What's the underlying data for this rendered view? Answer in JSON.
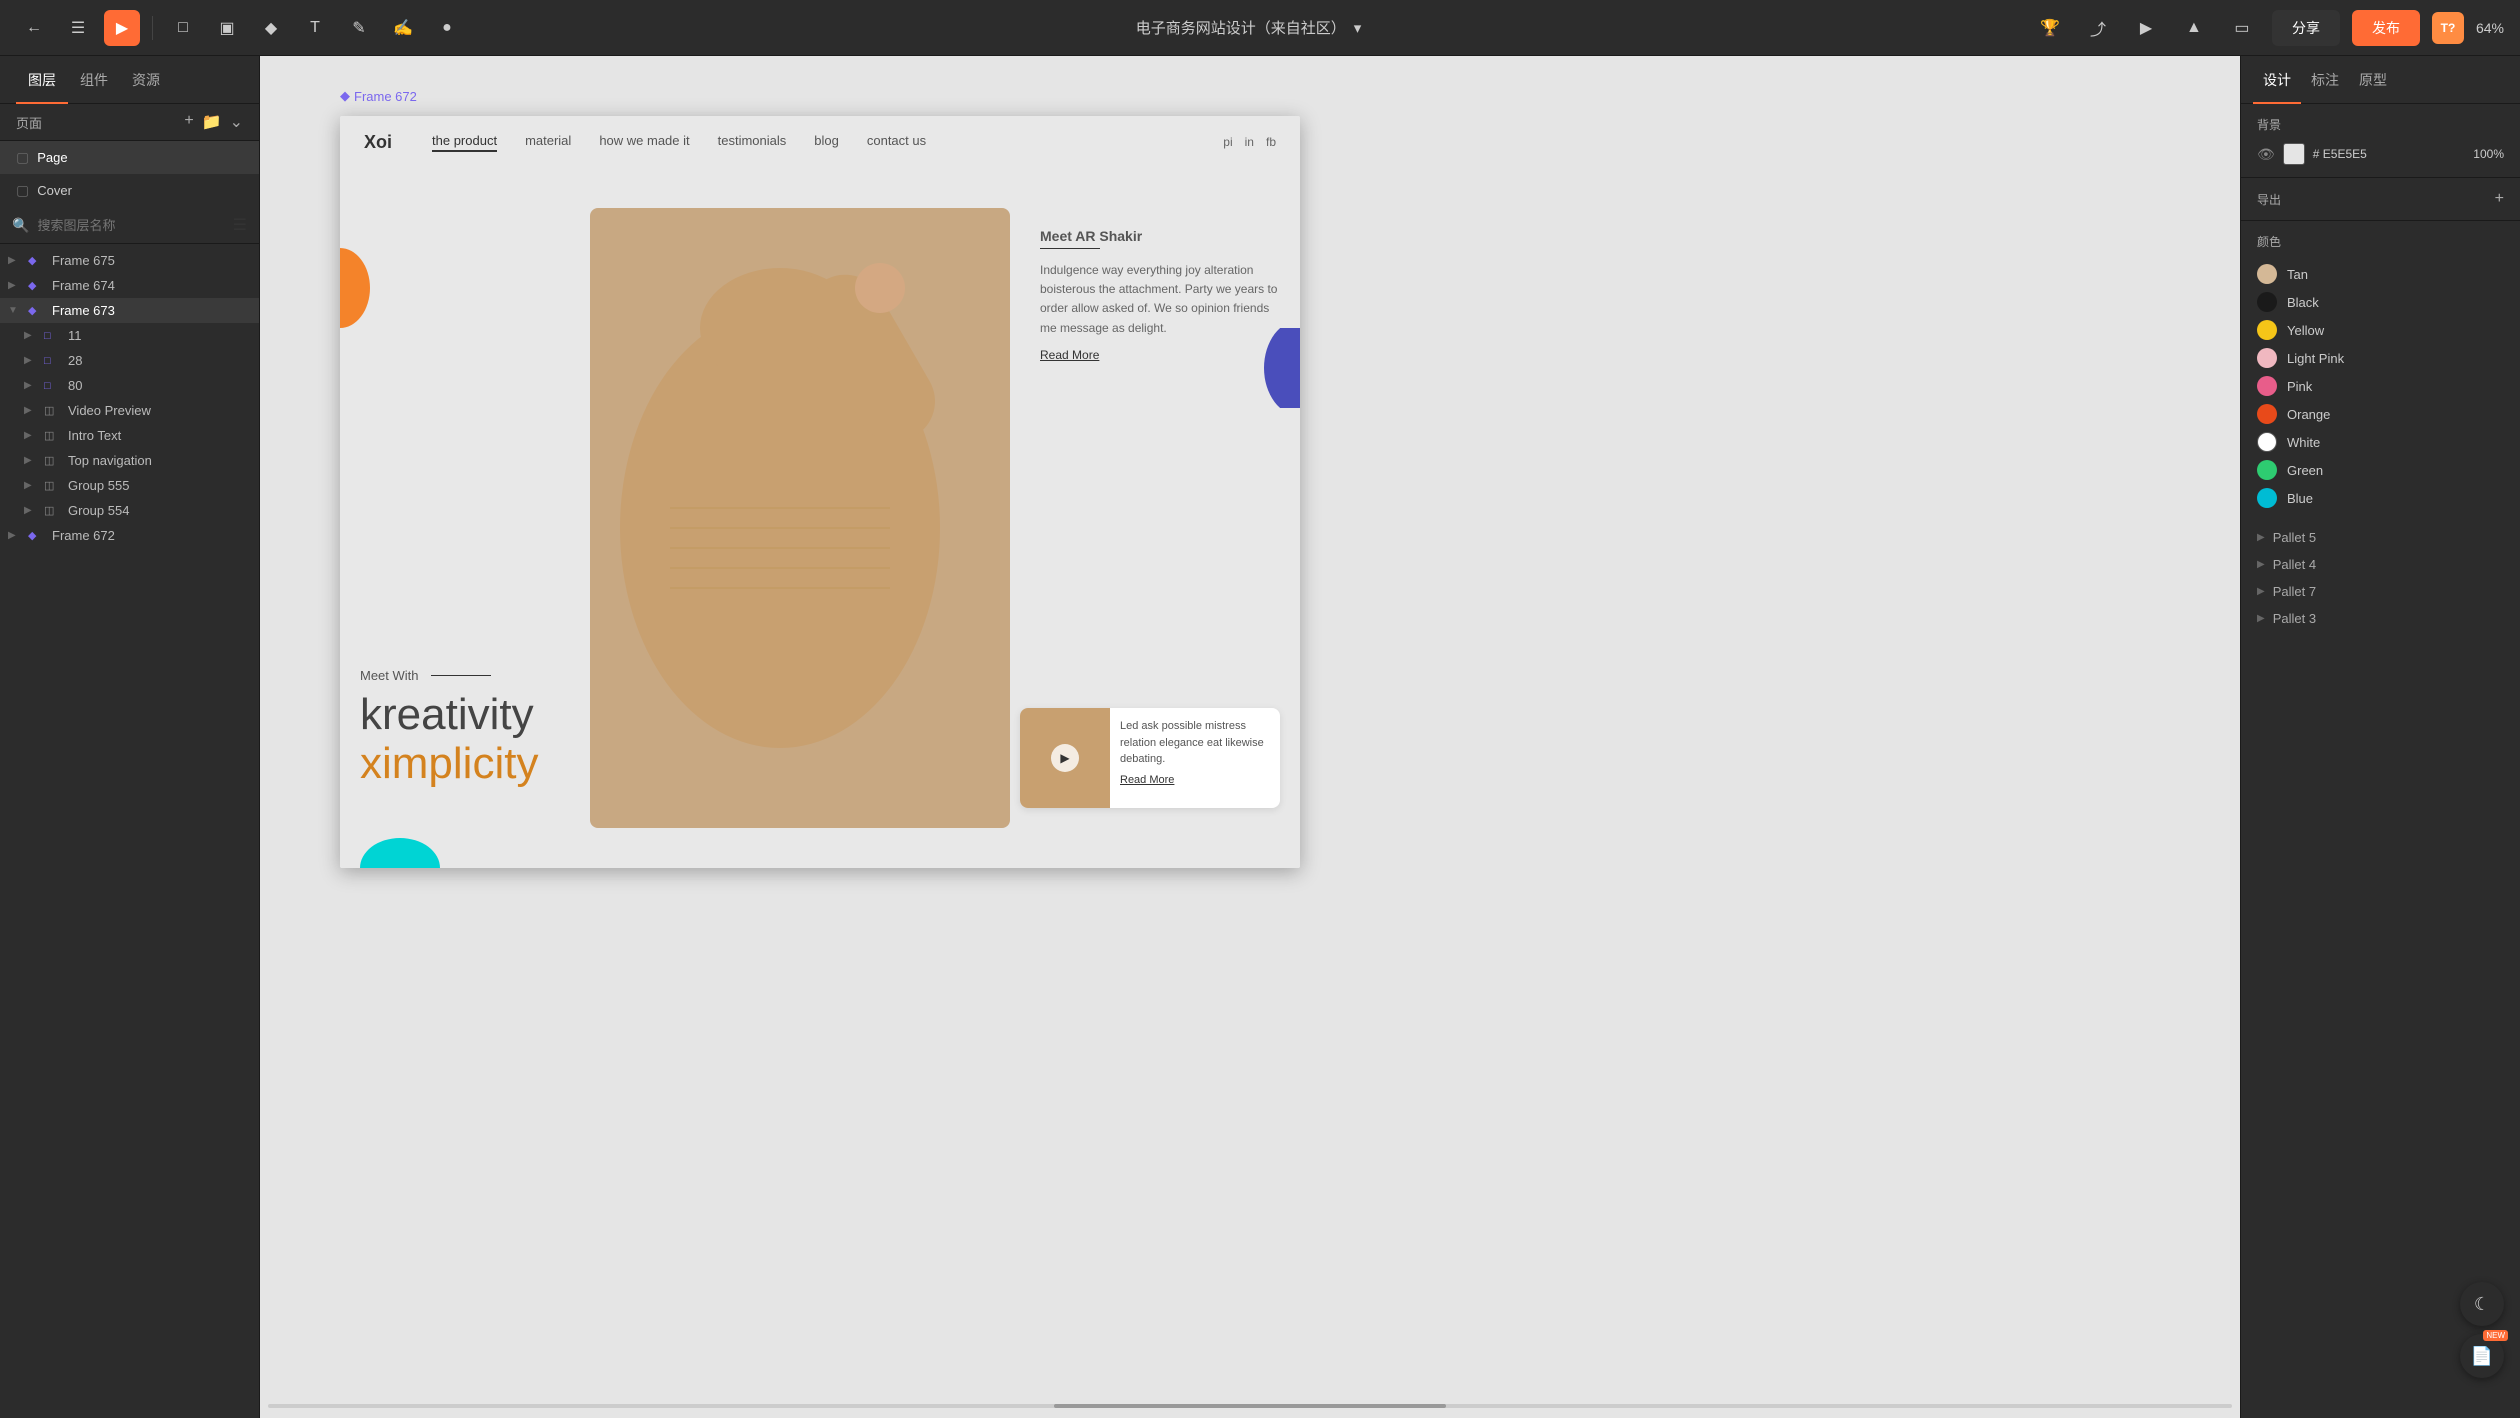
{
  "toolbar": {
    "title": "电子商务网站设计（来自社区）",
    "title_arrow": "▾",
    "share_label": "分享",
    "publish_label": "发布",
    "zoom": "64%",
    "avatar_text": "T?"
  },
  "left_panel": {
    "tabs": [
      "图层",
      "组件",
      "资源"
    ],
    "pages_label": "页面",
    "pages": [
      {
        "name": "Page",
        "active": true
      },
      {
        "name": "Cover",
        "active": false
      }
    ],
    "search_placeholder": "搜索图层名称",
    "layers": [
      {
        "id": "frame675",
        "name": "Frame 675",
        "indent": 0,
        "type": "diamond",
        "expanded": false
      },
      {
        "id": "frame674",
        "name": "Frame 674",
        "indent": 0,
        "type": "diamond",
        "expanded": false
      },
      {
        "id": "frame673",
        "name": "Frame 673",
        "indent": 0,
        "type": "diamond",
        "expanded": true,
        "active": true
      },
      {
        "id": "l11",
        "name": "11",
        "indent": 1,
        "type": "frame"
      },
      {
        "id": "l28",
        "name": "28",
        "indent": 1,
        "type": "frame"
      },
      {
        "id": "l80",
        "name": "80",
        "indent": 1,
        "type": "frame"
      },
      {
        "id": "video_preview",
        "name": "Video Preview",
        "indent": 1,
        "type": "group"
      },
      {
        "id": "intro_text",
        "name": "Intro Text",
        "indent": 1,
        "type": "group"
      },
      {
        "id": "top_navigation",
        "name": "Top navigation",
        "indent": 1,
        "type": "group"
      },
      {
        "id": "group555",
        "name": "Group 555",
        "indent": 1,
        "type": "group"
      },
      {
        "id": "group554",
        "name": "Group 554",
        "indent": 1,
        "type": "group"
      },
      {
        "id": "frame672",
        "name": "Frame 672",
        "indent": 0,
        "type": "diamond"
      }
    ]
  },
  "canvas": {
    "frame_label": "Frame 672",
    "mockup": {
      "nav": {
        "logo": "Xoi",
        "links": [
          "the product",
          "material",
          "how we made it",
          "testimonials",
          "blog",
          "contact us"
        ],
        "active_link": "the product",
        "social": [
          "pi",
          "in",
          "fb"
        ]
      },
      "hero": {
        "meet_ar_title": "Meet AR Shakir",
        "meet_desc": "Indulgence way everything joy alteration boisterous the attachment. Party we years to order allow asked of. We so opinion friends me message as delight.",
        "read_more": "Read More",
        "meet_with": "Meet With",
        "headline1": "kreativity",
        "headline2": "ximplicity",
        "video_text": "Led ask possible mistress relation elegance eat likewise debating.",
        "video_read_more": "Read More"
      }
    }
  },
  "right_panel": {
    "tabs": [
      "设计",
      "标注",
      "原型"
    ],
    "active_tab": "设计",
    "background": {
      "title": "背景",
      "color": "#E5E5E5",
      "opacity": "100%"
    },
    "export": {
      "title": "导出"
    },
    "colors": {
      "title": "颜色",
      "items": [
        {
          "name": "Tan",
          "color": "#d4b896"
        },
        {
          "name": "Black",
          "color": "#1a1a1a"
        },
        {
          "name": "Yellow",
          "color": "#f5c518"
        },
        {
          "name": "Light Pink",
          "color": "#f0b8c0"
        },
        {
          "name": "Pink",
          "color": "#e85d8a"
        },
        {
          "name": "Orange",
          "color": "#e84a1a"
        },
        {
          "name": "White",
          "color": "#ffffff"
        },
        {
          "name": "Green",
          "color": "#2ecc71"
        },
        {
          "name": "Blue",
          "color": "#00bcd4"
        }
      ]
    },
    "pallets": [
      {
        "name": "Pallet 5"
      },
      {
        "name": "Pallet 4"
      },
      {
        "name": "Pallet 7"
      },
      {
        "name": "Pallet 3"
      }
    ]
  }
}
